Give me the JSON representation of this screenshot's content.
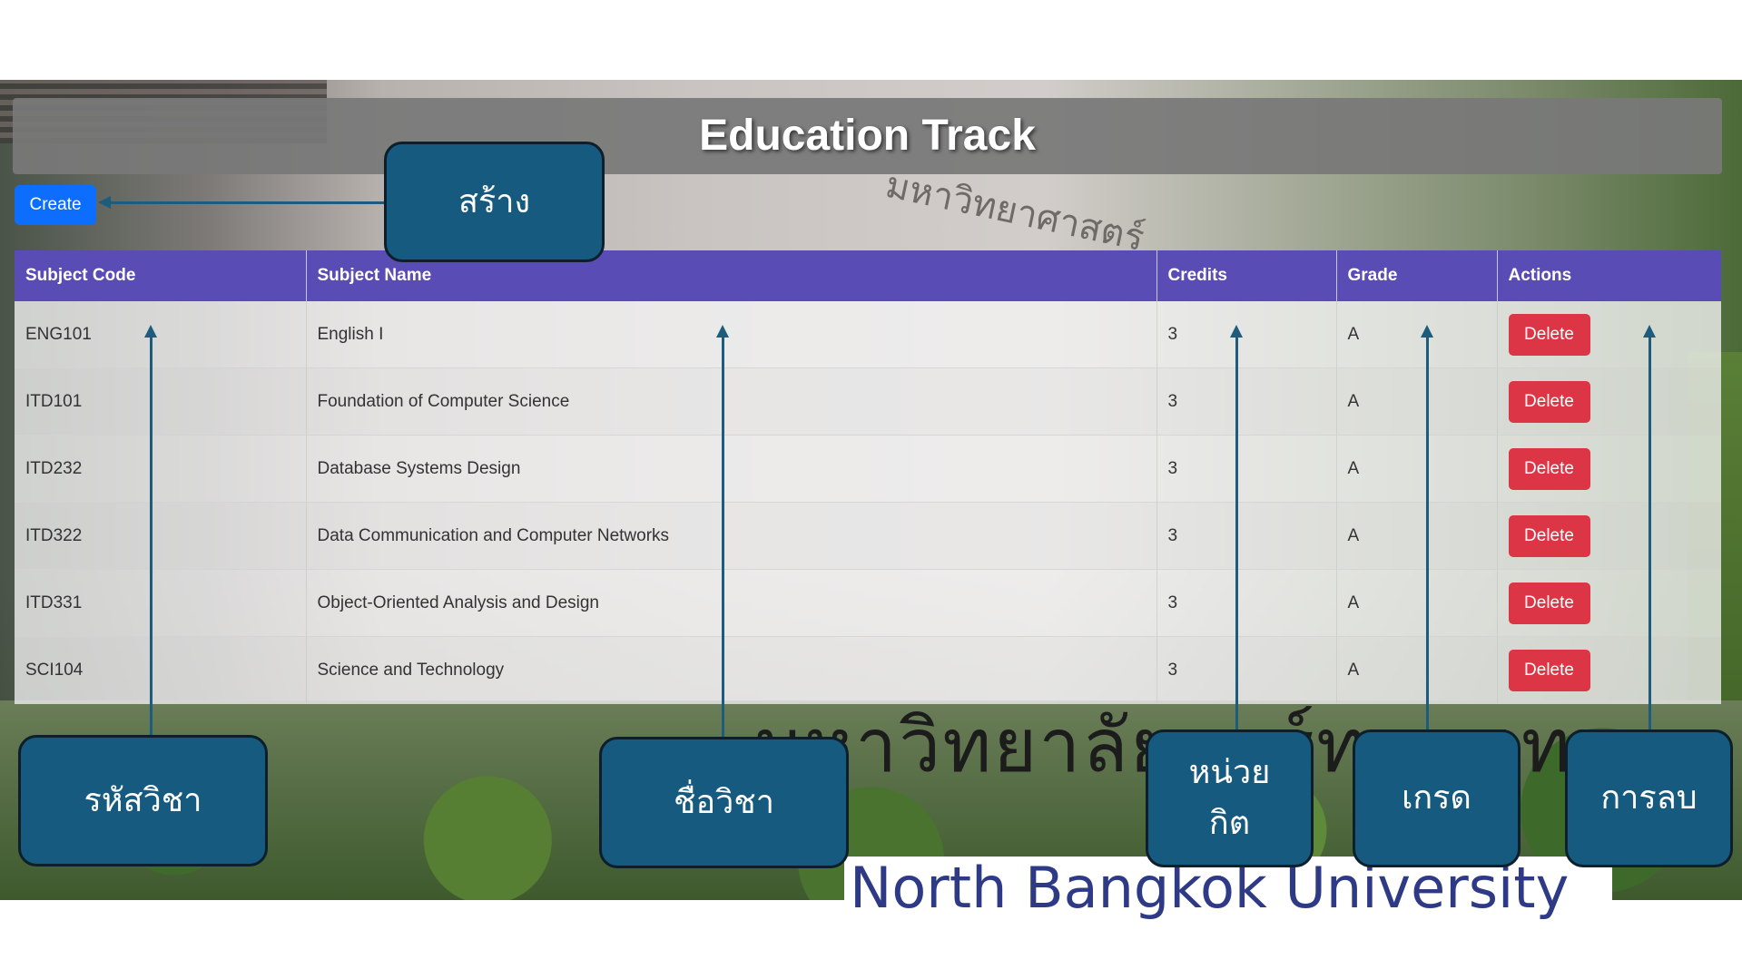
{
  "app": {
    "title": "Education Track"
  },
  "toolbar": {
    "create_label": "Create"
  },
  "background": {
    "sign_thai": "มหาวิทยาลัยนอร์ทกรุงเทพ",
    "sign_en": "North Bangkok University",
    "building_sign": "มหาวิทยาศาสตร์"
  },
  "table": {
    "headers": {
      "code": "Subject Code",
      "name": "Subject Name",
      "credits": "Credits",
      "grade": "Grade",
      "actions": "Actions"
    },
    "rows": [
      {
        "code": "ENG101",
        "name": "English I",
        "credits": "3",
        "grade": "A",
        "action": "Delete"
      },
      {
        "code": "ITD101",
        "name": "Foundation of Computer Science",
        "credits": "3",
        "grade": "A",
        "action": "Delete"
      },
      {
        "code": "ITD232",
        "name": "Database Systems Design",
        "credits": "3",
        "grade": "A",
        "action": "Delete"
      },
      {
        "code": "ITD322",
        "name": "Data Communication and Computer Networks",
        "credits": "3",
        "grade": "A",
        "action": "Delete"
      },
      {
        "code": "ITD331",
        "name": "Object-Oriented Analysis and Design",
        "credits": "3",
        "grade": "A",
        "action": "Delete"
      },
      {
        "code": "SCI104",
        "name": "Science and Technology",
        "credits": "3",
        "grade": "A",
        "action": "Delete"
      }
    ]
  },
  "callouts": {
    "create": "สร้าง",
    "code": "รหัสวิชา",
    "name": "ชื่อวิชา",
    "credits_line1": "หน่วย",
    "credits_line2": "กิต",
    "grade": "เกรด",
    "delete": "การลบ"
  },
  "colors": {
    "header_bg": "#5a4cb5",
    "create_button": "#0d6efd",
    "delete_button": "#dc3545",
    "callout_bg": "#175a80",
    "title_bar": "#787878"
  }
}
